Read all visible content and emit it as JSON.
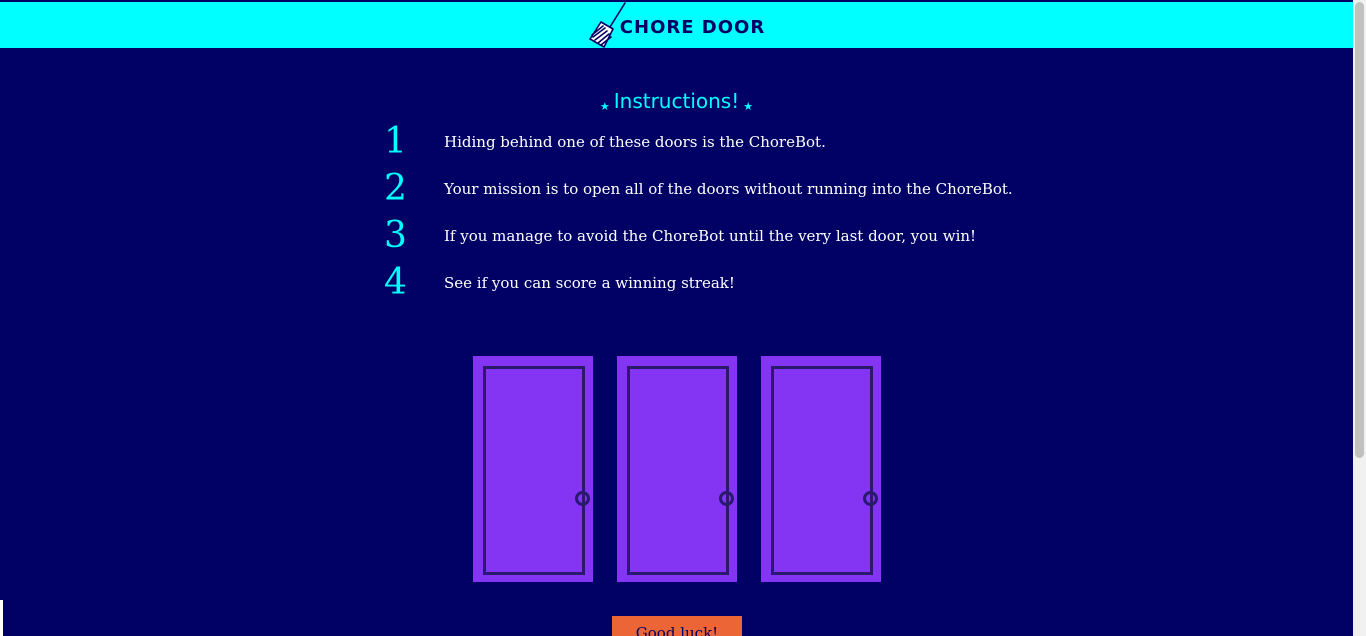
{
  "header": {
    "logo_icon": "broom-icon",
    "title": "CHORE DOOR",
    "background_color": "#00ffff",
    "text_color": "#010165"
  },
  "instructions": {
    "star_icon": "★",
    "title": "Instructions!",
    "steps": [
      {
        "number": "1",
        "text": "Hiding behind one of these doors is the ChoreBot."
      },
      {
        "number": "2",
        "text": "Your mission is to open all of the doors without running into the ChoreBot."
      },
      {
        "number": "3",
        "text": "If you manage to avoid the ChoreBot until the very last door, you win!"
      },
      {
        "number": "4",
        "text": "See if you can score a winning streak!"
      }
    ]
  },
  "doors": {
    "count": 3,
    "door_color": "#8335f3",
    "frame_color": "#2a1a6e",
    "icon": "closed-door-icon"
  },
  "start_button": {
    "label": "Good luck!",
    "color": "#eb6536"
  },
  "theme": {
    "background": "#010165",
    "accent": "#00ffff"
  }
}
